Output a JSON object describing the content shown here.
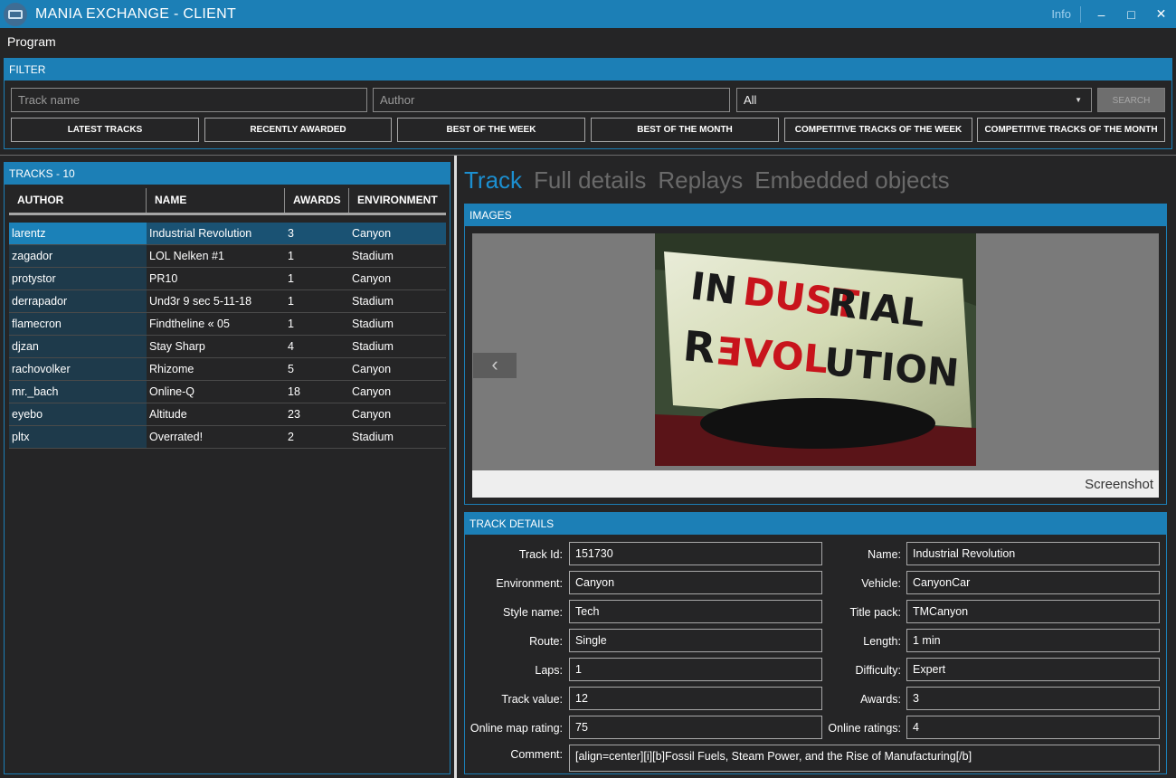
{
  "window": {
    "title": "MANIA EXCHANGE - CLIENT",
    "info_label": "Info",
    "minimize_glyph": "–",
    "maximize_glyph": "□",
    "close_glyph": "✕"
  },
  "menu": {
    "program_label": "Program"
  },
  "filter": {
    "header": "FILTER",
    "track_name_placeholder": "Track name",
    "author_placeholder": "Author",
    "environment_value": "All",
    "search_label": "SEARCH",
    "quick_buttons": [
      "LATEST TRACKS",
      "RECENTLY AWARDED",
      "BEST OF THE WEEK",
      "BEST OF THE MONTH",
      "COMPETITIVE TRACKS OF THE WEEK",
      "COMPETITIVE TRACKS OF THE MONTH"
    ]
  },
  "tracks": {
    "header": "TRACKS - 10",
    "columns": [
      "AUTHOR",
      "NAME",
      "AWARDS",
      "ENVIRONMENT"
    ],
    "rows": [
      {
        "author": "larentz",
        "name": "Industrial Revolution",
        "awards": "3",
        "environment": "Canyon"
      },
      {
        "author": "zagador",
        "name": "LOL Nelken #1",
        "awards": "1",
        "environment": "Stadium"
      },
      {
        "author": "protystor",
        "name": "PR10",
        "awards": "1",
        "environment": "Canyon"
      },
      {
        "author": "derrapador",
        "name": "Und3r 9 sec 5-11-18",
        "awards": "1",
        "environment": "Stadium"
      },
      {
        "author": "flamecron",
        "name": "Findtheline « 05",
        "awards": "1",
        "environment": "Stadium"
      },
      {
        "author": "djzan",
        "name": "Stay Sharp",
        "awards": "4",
        "environment": "Stadium"
      },
      {
        "author": "rachovolker",
        "name": "Rhizome",
        "awards": "5",
        "environment": "Canyon"
      },
      {
        "author": "mr._bach",
        "name": "Online-Q",
        "awards": "18",
        "environment": "Canyon"
      },
      {
        "author": "eyebo",
        "name": "Altitude",
        "awards": "23",
        "environment": "Canyon"
      },
      {
        "author": "pltx",
        "name": "Overrated!",
        "awards": "2",
        "environment": "Stadium"
      }
    ]
  },
  "tabs": [
    "Track",
    "Full details",
    "Replays",
    "Embedded objects"
  ],
  "images": {
    "header": "IMAGES",
    "caption": "Screenshot",
    "prev_glyph": "‹",
    "art_line1_a": "IN",
    "art_line1_b": "DUST",
    "art_line1_c": "RIAL",
    "art_line2_a": "R",
    "art_line2_b": "Ǝ",
    "art_line2_c": "VOL",
    "art_line2_d": "UTION"
  },
  "details": {
    "header": "TRACK DETAILS",
    "left": [
      {
        "label": "Track Id:",
        "value": "151730"
      },
      {
        "label": "Environment:",
        "value": "Canyon"
      },
      {
        "label": "Style name:",
        "value": "Tech"
      },
      {
        "label": "Route:",
        "value": "Single"
      },
      {
        "label": "Laps:",
        "value": "1"
      },
      {
        "label": "Track value:",
        "value": "12"
      },
      {
        "label": "Online map rating:",
        "value": "75"
      }
    ],
    "right": [
      {
        "label": "Name:",
        "value": "Industrial Revolution"
      },
      {
        "label": "Vehicle:",
        "value": "CanyonCar"
      },
      {
        "label": "Title pack:",
        "value": "TMCanyon"
      },
      {
        "label": "Length:",
        "value": "1 min"
      },
      {
        "label": "Difficulty:",
        "value": "Expert"
      },
      {
        "label": "Awards:",
        "value": "3"
      },
      {
        "label": "Online ratings:",
        "value": "4"
      }
    ],
    "comment_label": "Comment:",
    "comment_value": "[align=center][i][b]Fossil Fuels, Steam Power, and the Rise of Manufacturing[/b]"
  }
}
